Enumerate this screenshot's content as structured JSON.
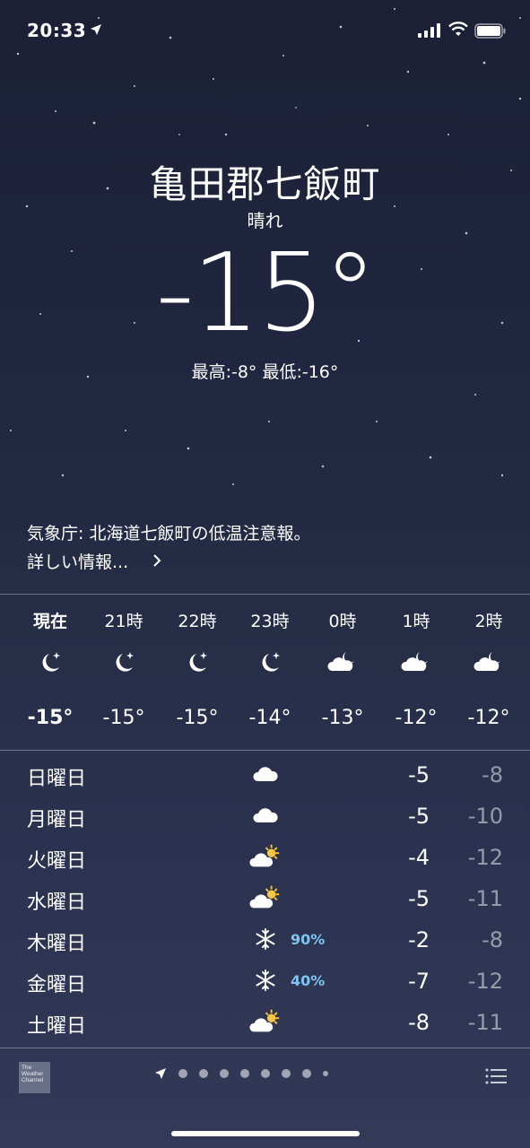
{
  "status_bar": {
    "time": "20:33"
  },
  "header": {
    "city": "亀田郡七飯町",
    "condition": "晴れ",
    "temperature": "-15°",
    "high_low": "最高:-8° 最低:-16°"
  },
  "alert": {
    "text": "気象庁: 北海道七飯町の低温注意報。",
    "more": "詳しい情報..."
  },
  "hourly": [
    {
      "label": "現在",
      "icon": "moon-stars-icon",
      "temp": "-15°"
    },
    {
      "label": "21時",
      "icon": "moon-stars-icon",
      "temp": "-15°"
    },
    {
      "label": "22時",
      "icon": "moon-stars-icon",
      "temp": "-15°"
    },
    {
      "label": "23時",
      "icon": "moon-stars-icon",
      "temp": "-14°"
    },
    {
      "label": "0時",
      "icon": "cloud-moon-icon",
      "temp": "-13°"
    },
    {
      "label": "1時",
      "icon": "cloud-moon-icon",
      "temp": "-12°"
    },
    {
      "label": "2時",
      "icon": "cloud-moon-icon",
      "temp": "-12°"
    }
  ],
  "daily": [
    {
      "day": "日曜日",
      "icon": "cloud-icon",
      "prob": "",
      "high": "-5",
      "low": "-8"
    },
    {
      "day": "月曜日",
      "icon": "cloud-icon",
      "prob": "",
      "high": "-5",
      "low": "-10"
    },
    {
      "day": "火曜日",
      "icon": "partly-sunny-icon",
      "prob": "",
      "high": "-4",
      "low": "-12"
    },
    {
      "day": "水曜日",
      "icon": "partly-sunny-icon",
      "prob": "",
      "high": "-5",
      "low": "-11"
    },
    {
      "day": "木曜日",
      "icon": "snowflake-icon",
      "prob": "90%",
      "high": "-2",
      "low": "-8"
    },
    {
      "day": "金曜日",
      "icon": "snowflake-icon",
      "prob": "40%",
      "high": "-7",
      "low": "-12"
    },
    {
      "day": "土曜日",
      "icon": "partly-sunny-icon",
      "prob": "",
      "high": "-8",
      "low": "-11"
    }
  ],
  "footer": {
    "provider_logo": "The Weather Channel",
    "page_count": 9,
    "current_page": 1
  },
  "colors": {
    "precip": "#7fc4f0",
    "sun": "#f5c744",
    "background_top": "#1b2036",
    "background_bottom": "#323a58"
  }
}
